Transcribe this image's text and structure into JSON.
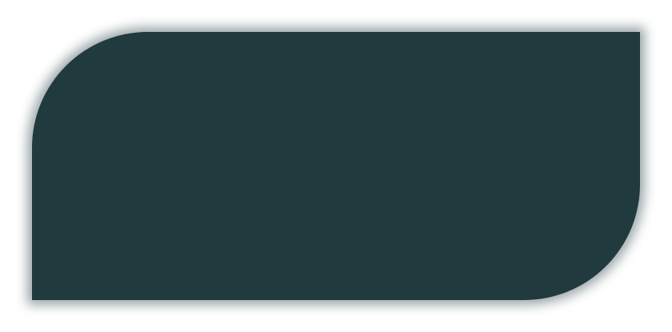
{
  "panel": {
    "fill_color": "#213a3e",
    "shadow_color": "#213a3e",
    "background_color": "#ffffff"
  }
}
